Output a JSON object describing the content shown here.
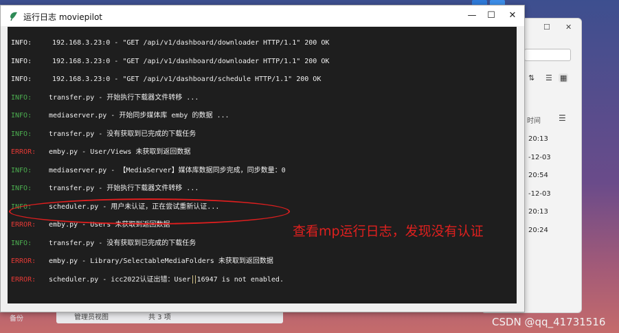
{
  "window": {
    "title": "运行日志 moviepilot",
    "minimize_label": "—",
    "maximize_label": "☐",
    "close_label": "✕"
  },
  "console": {
    "lines": [
      {
        "level": "INFO:",
        "style": "info-plain",
        "message": "192.168.3.23:0 - \"GET /api/v1/dashboard/downloader HTTP/1.1\" 200 OK"
      },
      {
        "level": "INFO:",
        "style": "info-plain",
        "message": "192.168.3.23:0 - \"GET /api/v1/dashboard/downloader HTTP/1.1\" 200 OK"
      },
      {
        "level": "INFO:",
        "style": "info-plain",
        "message": "192.168.3.23:0 - \"GET /api/v1/dashboard/schedule HTTP/1.1\" 200 OK"
      },
      {
        "level": "INFO:",
        "style": "info-green",
        "message": "transfer.py - 开始执行下载器文件转移 ..."
      },
      {
        "level": "INFO:",
        "style": "info-green",
        "message": "mediaserver.py - 开始同步媒体库 emby 的数据 ..."
      },
      {
        "level": "INFO:",
        "style": "info-green",
        "message": "transfer.py - 没有获取到已完成的下载任务"
      },
      {
        "level": "ERROR:",
        "style": "error",
        "message": "emby.py - User/Views 未获取到返回数据"
      },
      {
        "level": "INFO:",
        "style": "info-green",
        "message": "mediaserver.py - 【MediaServer】媒体库数据同步完成，同步数量：0"
      },
      {
        "level": "INFO:",
        "style": "info-green",
        "message": "transfer.py - 开始执行下载器文件转移 ..."
      },
      {
        "level": "INFO:",
        "style": "info-green",
        "message": "scheduler.py - 用户未认证，正在尝试重新认证..."
      },
      {
        "level": "ERROR:",
        "style": "error",
        "message": "emby.py - Users 未获取到返回数据"
      },
      {
        "level": "INFO:",
        "style": "info-green",
        "message": "transfer.py - 没有获取到已完成的下载任务"
      },
      {
        "level": "ERROR:",
        "style": "error",
        "message": "emby.py - Library/SelectableMediaFolders 未获取到返回数据"
      },
      {
        "level": "ERROR:",
        "style": "error",
        "message_a": "scheduler.py - icc2022认证出错：User",
        "message_b": "16947 is not enabled."
      }
    ]
  },
  "annotation": {
    "text": "查看mp运行日志，发现没有认证"
  },
  "background_window": {
    "header_label": "时间",
    "times": [
      "20:13",
      "-12-03",
      "20:54",
      "-12-03",
      "20:13",
      "20:24"
    ]
  },
  "taskbar": {
    "left_label": "备份",
    "panel_label_1": "管理员视图",
    "panel_label_2": "共 3 项"
  },
  "watermark": "CSDN @qq_41731516",
  "colors": {
    "info": "#4caf50",
    "error": "#e53935",
    "annotation": "#e0201e",
    "console_bg": "#1e1e1e"
  }
}
